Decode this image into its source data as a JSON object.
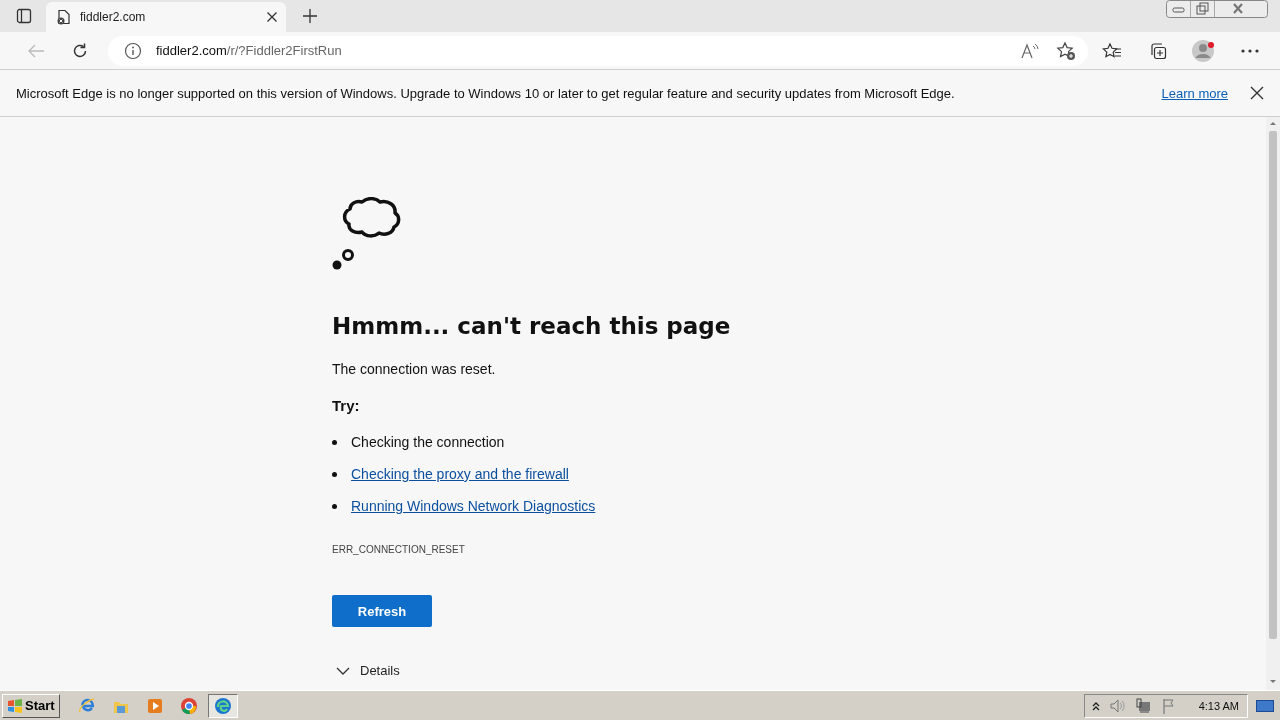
{
  "browser": {
    "tab": {
      "title": "fiddler2.com"
    },
    "address": {
      "host": "fiddler2.com",
      "path": "/r/?Fiddler2FirstRun"
    }
  },
  "infobar": {
    "message": "Microsoft Edge is no longer supported on this version of Windows. Upgrade to Windows 10 or later to get regular feature and security updates from Microsoft Edge.",
    "link": "Learn more"
  },
  "error_page": {
    "heading": "Hmmm... can't reach this page",
    "description": "The connection was reset.",
    "try_label": "Try:",
    "suggestions": [
      {
        "text": "Checking the connection",
        "kind": "text"
      },
      {
        "text": "Checking the proxy and the firewall",
        "kind": "link"
      },
      {
        "text": "Running Windows Network Diagnostics",
        "kind": "link"
      }
    ],
    "error_code": "ERR_CONNECTION_RESET",
    "button": "Refresh",
    "details": "Details"
  },
  "taskbar": {
    "start": "Start",
    "apps": [
      {
        "kind": "ie",
        "selected": false
      },
      {
        "kind": "explorer",
        "selected": false
      },
      {
        "kind": "media",
        "selected": false
      },
      {
        "kind": "chrome",
        "selected": false
      },
      {
        "kind": "edge",
        "selected": true
      }
    ],
    "clock": "4:13 AM"
  }
}
